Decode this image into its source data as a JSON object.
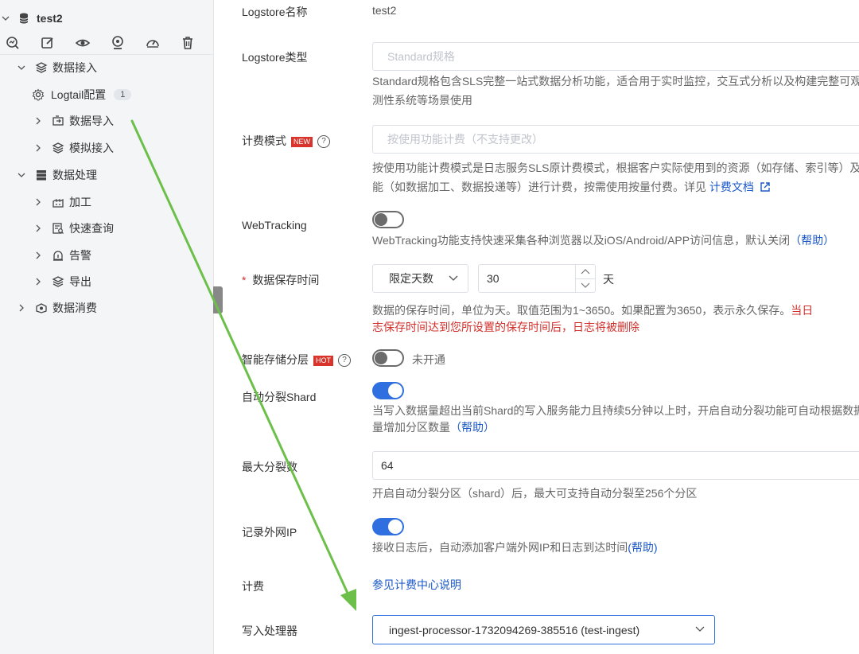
{
  "sidebar": {
    "project": "test2",
    "toolbar_icons": [
      "search-chart-icon",
      "edit-icon",
      "eye-icon",
      "monitor-icon",
      "gauge-icon",
      "trash-icon"
    ],
    "items": [
      {
        "label": "数据接入",
        "icon": "layers-icon",
        "expanded": true
      },
      {
        "label": "Logtail配置",
        "icon": "gear-icon",
        "badge": "1"
      },
      {
        "label": "数据导入",
        "icon": "import-icon"
      },
      {
        "label": "模拟接入",
        "icon": "layers-icon"
      },
      {
        "label": "数据处理",
        "icon": "database-icon",
        "expanded": true
      },
      {
        "label": "加工",
        "icon": "factory-icon"
      },
      {
        "label": "快速查询",
        "icon": "query-icon"
      },
      {
        "label": "告警",
        "icon": "alarm-icon"
      },
      {
        "label": "导出",
        "icon": "layers-icon"
      },
      {
        "label": "数据消费",
        "icon": "consume-icon"
      }
    ]
  },
  "form": {
    "logstore_name": {
      "label": "Logstore名称",
      "value": "test2"
    },
    "logstore_type": {
      "label": "Logstore类型",
      "placeholder": "Standard规格",
      "help_line1": "Standard规格包含SLS完整一站式数据分析功能，适合用于实时监控，交互式分析以及构建完整可观",
      "help_line2": "测性系统等场景使用"
    },
    "billing_mode": {
      "label": "计费模式",
      "tag": "NEW",
      "placeholder": "按使用功能计费（不支持更改）",
      "help_line1": "按使用功能计费模式是日志服务SLS原计费模式，根据客户实际使用到的资源（如存储、索引等）及",
      "help_line2_prefix": "能（如数据加工、数据投递等）进行计费，按需使用按量付费。详见 ",
      "help_link": "计费文档"
    },
    "webtracking": {
      "label": "WebTracking",
      "enabled": false,
      "help": "WebTracking功能支持快速采集各种浏览器以及iOS/Android/APP访问信息，默认关闭",
      "help_link": "（帮助）"
    },
    "retention": {
      "required_mark": "*",
      "label": "数据保存时间",
      "mode": "限定天数",
      "days": "30",
      "unit": "天",
      "help_line1": "数据的保存时间，单位为天。取值范围为1~3650。如果配置为3650，表示永久保存。",
      "help_line1_red": "当日",
      "help_line2_red": "志保存时间达到您所设置的保存时间后，日志将被删除"
    },
    "tiered_storage": {
      "label": "智能存储分层",
      "tag": "HOT",
      "enabled": false,
      "status": "未开通"
    },
    "auto_split": {
      "label": "自动分裂Shard",
      "enabled": true,
      "help_line1": "当写入数据量超出当前Shard的写入服务能力且持续5分钟以上时，开启自动分裂功能可自动根据数据",
      "help_line2": "量增加分区数量",
      "help_link": "（帮助）"
    },
    "max_split": {
      "label": "最大分裂数",
      "value": "64",
      "help": "开启自动分裂分区（shard）后，最大可支持自动分裂至256个分区"
    },
    "record_ip": {
      "label": "记录外网IP",
      "enabled": true,
      "help": "接收日志后，自动添加客户端外网IP和日志到达时间",
      "help_link": "(帮助)"
    },
    "billing": {
      "label": "计费",
      "link": "参见计费中心说明"
    },
    "ingest_processor": {
      "label": "写入处理器",
      "value": "ingest-processor-1732094269-385516 (test-ingest)"
    }
  },
  "colors": {
    "accent": "#2f6fe0",
    "link": "#1b58c7",
    "warning": "#d0302b",
    "annotation_arrow": "#6cc04a"
  }
}
